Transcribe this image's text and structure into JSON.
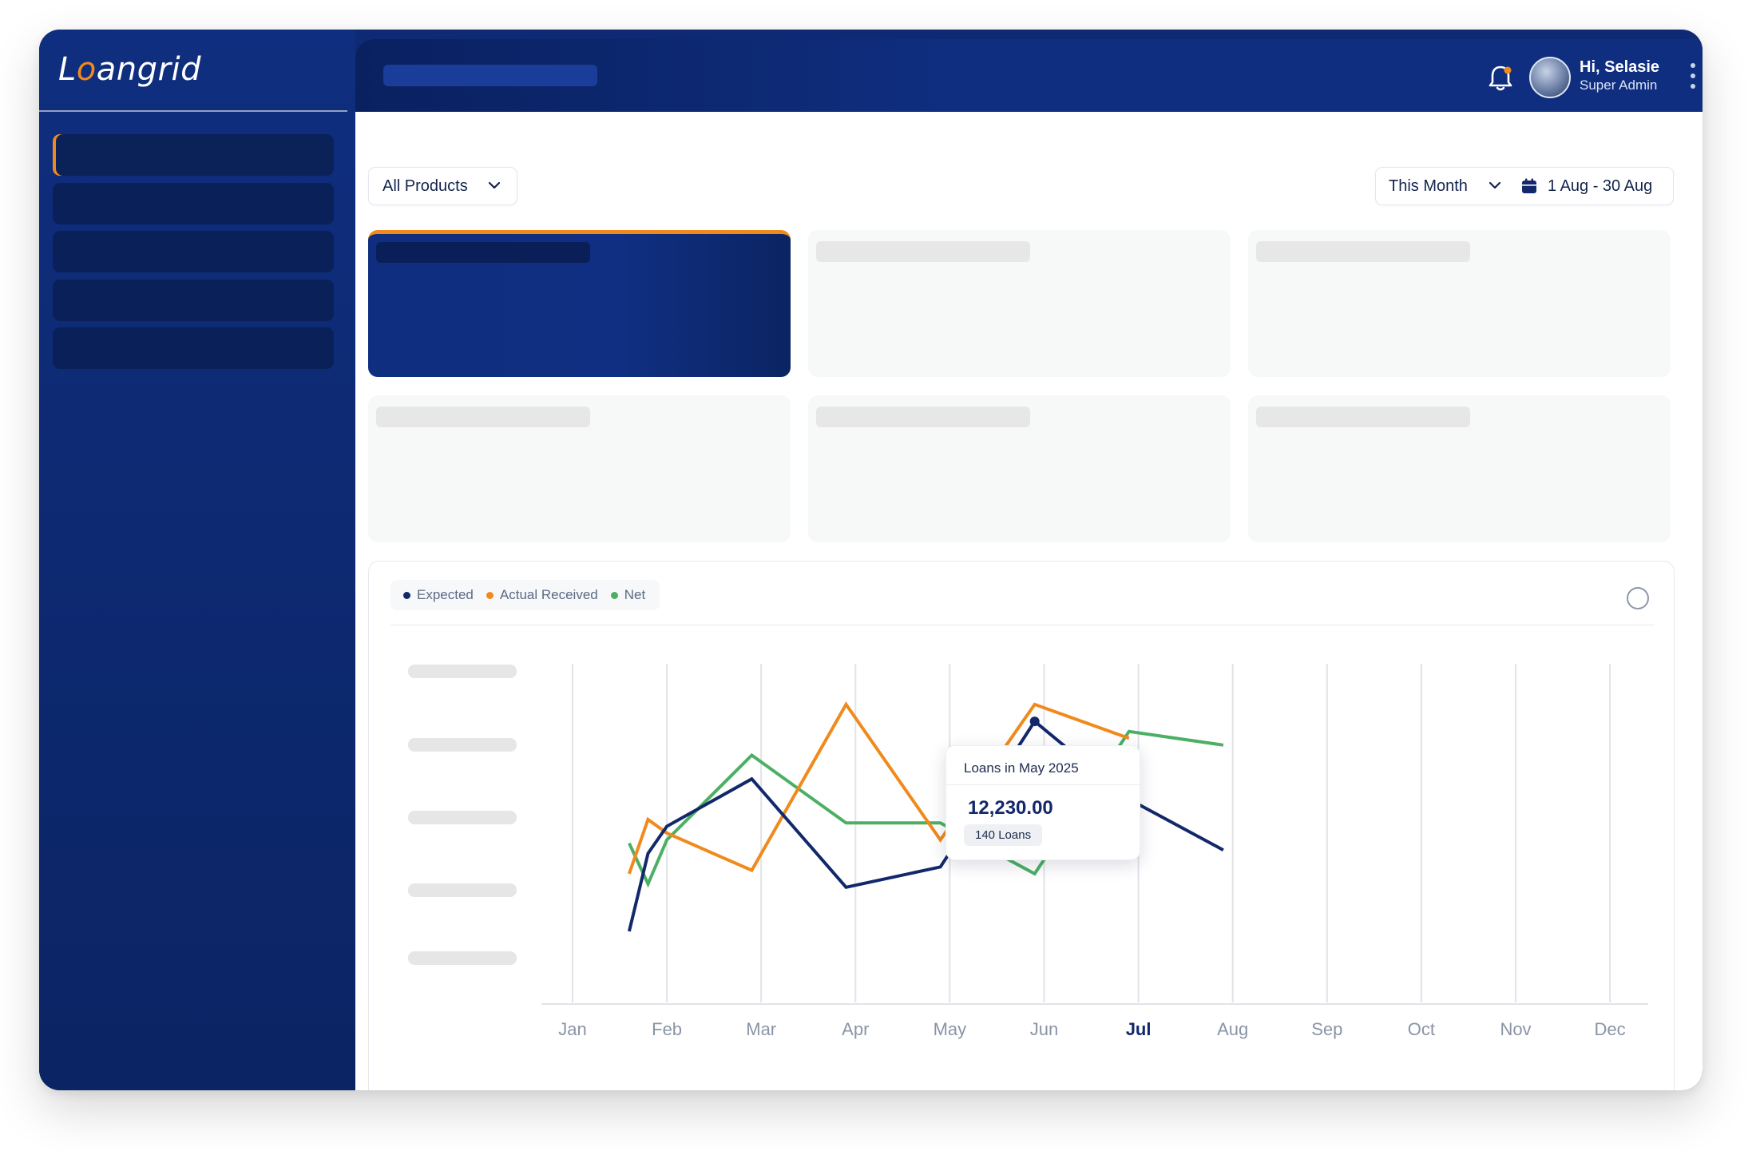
{
  "app": {
    "logo_pre": "L",
    "logo_o": "o",
    "logo_post": "angrid"
  },
  "header": {
    "greeting": "Hi, Selasie",
    "role": "Super Admin"
  },
  "filters": {
    "products": "All Products",
    "period": "This Month",
    "date_range": "1 Aug - 30 Aug"
  },
  "chart_panel": {
    "legend": [
      {
        "label": "Expected",
        "color": "#13286b"
      },
      {
        "label": "Actual Received",
        "color": "#f08a1c"
      },
      {
        "label": "Net",
        "color": "#4caf64"
      }
    ]
  },
  "tooltip": {
    "title": "Loans in May 2025",
    "value": "12,230.00",
    "badge": "140 Loans"
  },
  "chart_data": {
    "type": "line",
    "categories": [
      "Jan",
      "Feb",
      "Mar",
      "Apr",
      "May",
      "Jun",
      "Jul",
      "Aug",
      "Sep",
      "Oct",
      "Nov",
      "Dec"
    ],
    "highlighted_category": "Jul",
    "series": [
      {
        "name": "Expected",
        "color": "#13286b",
        "x": [
          0.6,
          0.8,
          1.0,
          1.9,
          2.9,
          3.9,
          4.9,
          5.9,
          6.9
        ],
        "values": [
          21,
          44,
          52,
          66,
          34,
          40,
          83,
          60,
          45
        ]
      },
      {
        "name": "Actual Received",
        "color": "#f08a1c",
        "x": [
          0.6,
          0.8,
          1.0,
          1.9,
          2.9,
          3.9,
          4.9,
          5.9
        ],
        "values": [
          38,
          54,
          50,
          39,
          88,
          48,
          88,
          78
        ]
      },
      {
        "name": "Net",
        "color": "#4caf64",
        "x": [
          0.6,
          0.8,
          1.0,
          1.9,
          2.9,
          3.9,
          4.9,
          5.9,
          6.9
        ],
        "values": [
          47,
          35,
          48,
          73,
          53,
          53,
          38,
          80,
          76
        ]
      }
    ],
    "ylim": [
      0,
      100
    ],
    "grid": "vertical"
  }
}
